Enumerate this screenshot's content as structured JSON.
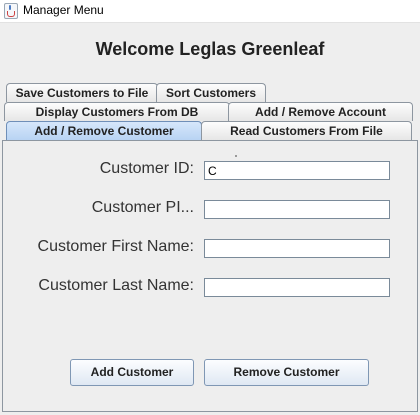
{
  "window": {
    "title": "Manager Menu",
    "icon": "java-cup-icon"
  },
  "header": {
    "welcome": "Welcome Leglas Greenleaf"
  },
  "tabs": {
    "row1": [
      "Save Customers to File",
      "Sort Customers"
    ],
    "row2": [
      "Display Customers From DB",
      "Add / Remove Account"
    ],
    "row3": [
      "Add / Remove Customer",
      "Read Customers From File"
    ],
    "selected": "Add / Remove Customer"
  },
  "form": {
    "customer_id": {
      "label": "Customer ID:",
      "value": "C"
    },
    "customer_pin": {
      "label": "Customer PI...",
      "value": ""
    },
    "first_name": {
      "label": "Customer First Name:",
      "value": ""
    },
    "last_name": {
      "label": "Customer Last Name:",
      "value": ""
    }
  },
  "actions": {
    "add": "Add Customer",
    "remove": "Remove Customer"
  },
  "colors": {
    "selected_tab": "#b8d3f3",
    "button_border": "#7f97b4"
  }
}
